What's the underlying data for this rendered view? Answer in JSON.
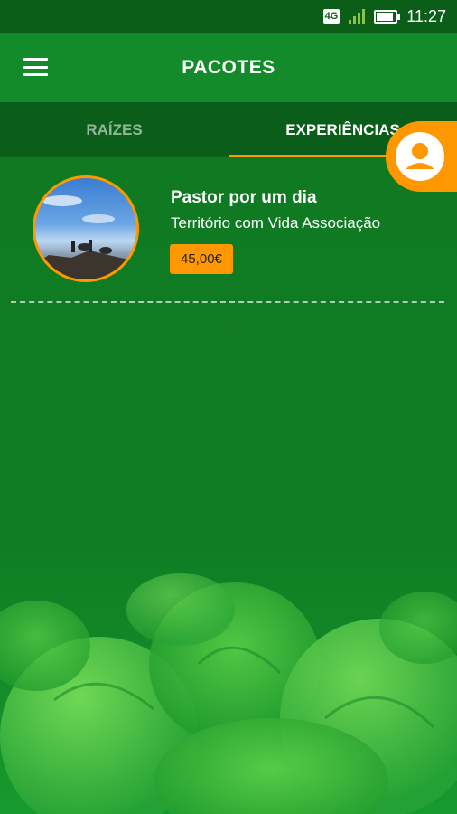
{
  "status_bar": {
    "network": "4G",
    "time": "11:27",
    "battery_level": 0.8,
    "icons": [
      "network-badge-icon",
      "signal-icon",
      "battery-icon"
    ]
  },
  "app_bar": {
    "title": "PACOTES",
    "menu_icon": "hamburger-menu-icon"
  },
  "tabs": [
    {
      "label": "RAÍZES",
      "active": false
    },
    {
      "label": "EXPERIÊNCIAS",
      "active": true
    }
  ],
  "profile_button": {
    "icon": "user-profile-icon"
  },
  "packages": [
    {
      "title": "Pastor por um dia",
      "organization": "Território com Vida Associação",
      "price": "45,00€"
    }
  ],
  "colors": {
    "primary": "#138b2a",
    "primary_dark": "#0b5d1a",
    "accent": "#ff9800"
  }
}
